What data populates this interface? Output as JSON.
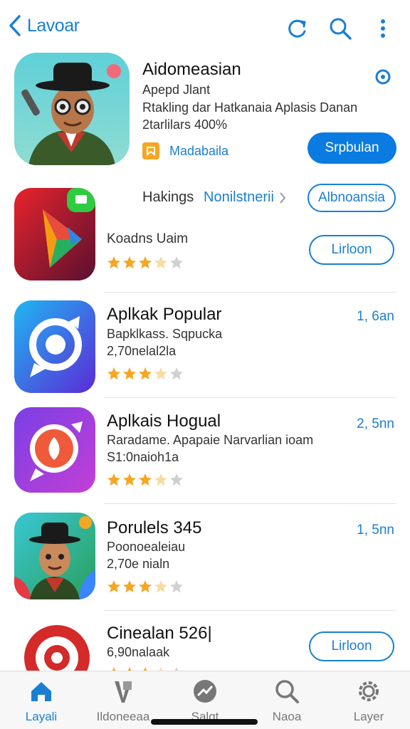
{
  "header": {
    "back_label": "Lavoar",
    "icons": [
      "refresh-icon",
      "search-icon",
      "more-vertical-icon"
    ]
  },
  "featured": {
    "title": "Aidomeasian",
    "line1": "Apepd Jlant",
    "line2": "Rtakling dar Hatkanaia Aplasis Danan",
    "line3": "2tarlilars 400%",
    "tag_label": "Madabaila",
    "button_label": "Srpbulan"
  },
  "row_hakings": {
    "label": "Hakings",
    "link_label": "Nonilstnerii",
    "button_top_label": "Albnoansia",
    "sub": "Koadns Uaim",
    "button_label": "Lirloon",
    "rating": 3
  },
  "apps": [
    {
      "title": "Aplkak Popular",
      "sub1": "Bapklkass. Sqpucka",
      "sub2": "2,70nelal2la",
      "size": "1, 6an",
      "rating": 3
    },
    {
      "title": "Aplkais Hogual",
      "sub1": "Raradame. Apapaie Narvarlian ioam",
      "sub2": "S1:0naioh1a",
      "size": "2, 5nn",
      "rating": 3
    },
    {
      "title": "Porulels 345",
      "sub1": "Poonoealeiau",
      "sub2": "2,70e nialn",
      "size": "1, 5nn",
      "rating": 3
    },
    {
      "title": "Cinealan 526|",
      "sub1": "6,90nalaak",
      "button_label": "Lirloon",
      "rating": 3
    }
  ],
  "tabs": [
    {
      "label": "Layali",
      "icon": "home-icon",
      "active": true
    },
    {
      "label": "Ildoneeaa",
      "icon": "apps-icon",
      "active": false
    },
    {
      "label": "Salgt",
      "icon": "trending-icon",
      "active": false
    },
    {
      "label": "Naoa",
      "icon": "search-icon",
      "active": false
    },
    {
      "label": "Layer",
      "icon": "gear-icon",
      "active": false
    }
  ],
  "colors": {
    "accent": "#1a7fd4",
    "button_solid": "#0a7be0",
    "star": "#f5a623",
    "star_empty": "#d0d0d0"
  }
}
